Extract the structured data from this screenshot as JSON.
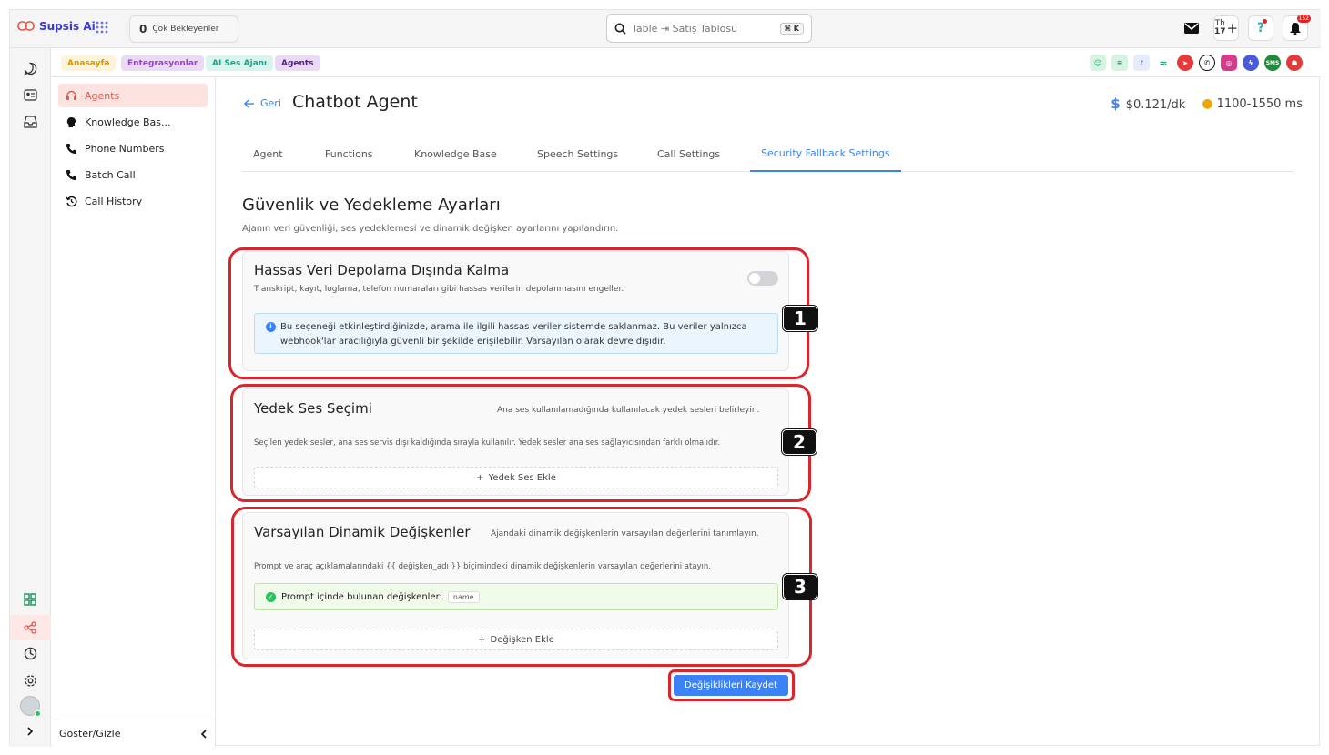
{
  "app": {
    "brand": "Supsis Ai"
  },
  "topbar": {
    "pending_count": "0",
    "pending_label": "Çok Bekleyenler",
    "search_text": "Table ⇥ Satış Tablosu",
    "search_kbd": "⌘ K",
    "calendar_text": "Th",
    "calendar_day": "17",
    "notification_count": "152"
  },
  "breadcrumbs": [
    {
      "label": "Anasayfa",
      "bg": "#fdf3d7",
      "color": "#d99500"
    },
    {
      "label": "Entegrasyonlar",
      "bg": "#ead9f7",
      "color": "#9b3fd4"
    },
    {
      "label": "AI Ses Ajanı",
      "bg": "#d6f5ef",
      "color": "#1aa384"
    },
    {
      "label": "Agents",
      "bg": "#ead9f7",
      "color": "#5b1f8a"
    }
  ],
  "sidebar": {
    "items": [
      {
        "label": "Agents"
      },
      {
        "label": "Knowledge Bas..."
      },
      {
        "label": "Phone Numbers"
      },
      {
        "label": "Batch Call"
      },
      {
        "label": "Call History"
      }
    ],
    "footer_label": "Göster/Gizle"
  },
  "header": {
    "back_label": "Geri",
    "title": "Chatbot Agent",
    "cost": "$0.121/dk",
    "latency": "1100-1550 ms"
  },
  "tabs": [
    {
      "label": "Agent"
    },
    {
      "label": "Functions"
    },
    {
      "label": "Knowledge Base"
    },
    {
      "label": "Speech Settings"
    },
    {
      "label": "Call Settings"
    },
    {
      "label": "Security Fallback Settings"
    }
  ],
  "section": {
    "title": "Güvenlik ve Yedekleme Ayarları",
    "subtitle": "Ajanın veri güvenliği, ses yedeklemesi ve dinamik değişken ayarlarını yapılandırın."
  },
  "card1": {
    "title": "Hassas Veri Depolama Dışında Kalma",
    "desc": "Transkript, kayıt, loglama, telefon numaraları gibi hassas verilerin depolanmasını engeller.",
    "toggle_on": false,
    "info_line1": "Bu seçeneği etkinleştirdiğinizde, arama ile ilgili hassas veriler sistemde saklanmaz. Bu veriler yalnızca",
    "info_line2": "webhook'lar aracılığıyla güvenli bir şekilde erişilebilir. Varsayılan olarak devre dışıdır."
  },
  "card2": {
    "title": "Yedek Ses Seçimi",
    "aside": "Ana ses kullanılamadığında kullanılacak yedek sesleri belirleyin.",
    "desc": "Seçilen yedek sesler, ana ses servis dışı kaldığında sırayla kullanılır. Yedek sesler ana ses sağlayıcısından farklı olmalıdır.",
    "add_label": "Yedek Ses Ekle"
  },
  "card3": {
    "title": "Varsayılan Dinamik Değişkenler",
    "aside": "Ajandaki dinamik değişkenlerin varsayılan değerlerini tanımlayın.",
    "desc": "Prompt ve araç açıklamalarındaki {{ değişken_adı }} biçimindeki dinamik değişkenlerin varsayılan değerlerini atayın.",
    "found_label": "Prompt içinde bulunan değişkenler:",
    "variable": "name",
    "add_label": "Değişken Ekle"
  },
  "annotations": [
    "1",
    "2",
    "3"
  ],
  "save_label": "Değişiklikleri Kaydet"
}
